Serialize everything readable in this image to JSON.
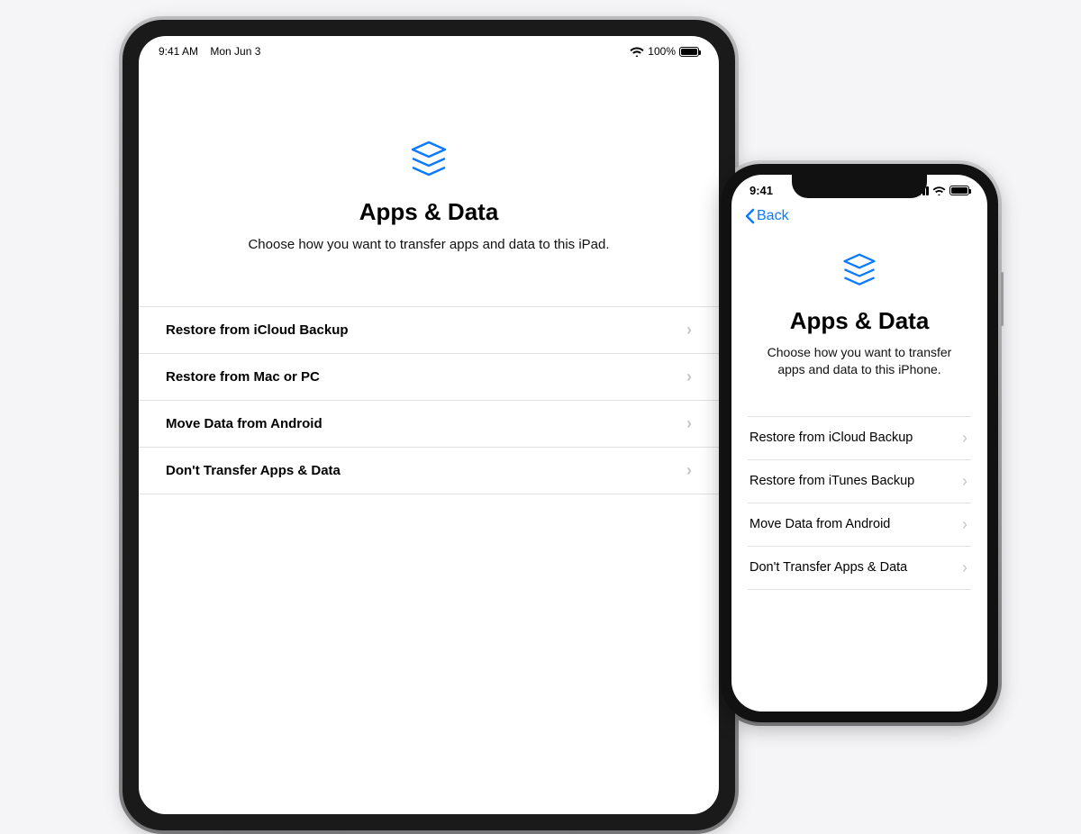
{
  "colors": {
    "accent": "#0a7aff"
  },
  "ipad": {
    "status": {
      "time": "9:41 AM",
      "date": "Mon Jun 3",
      "battery_pct": "100%"
    },
    "title": "Apps & Data",
    "subtitle": "Choose how you want to transfer apps and data to this iPad.",
    "options": [
      "Restore from iCloud Backup",
      "Restore from Mac or PC",
      "Move Data from Android",
      "Don't Transfer Apps & Data"
    ]
  },
  "iphone": {
    "status": {
      "time": "9:41"
    },
    "back_label": "Back",
    "title": "Apps & Data",
    "subtitle": "Choose how you want to transfer apps and data to this iPhone.",
    "options": [
      "Restore from iCloud Backup",
      "Restore from iTunes Backup",
      "Move Data from Android",
      "Don't Transfer Apps & Data"
    ]
  }
}
